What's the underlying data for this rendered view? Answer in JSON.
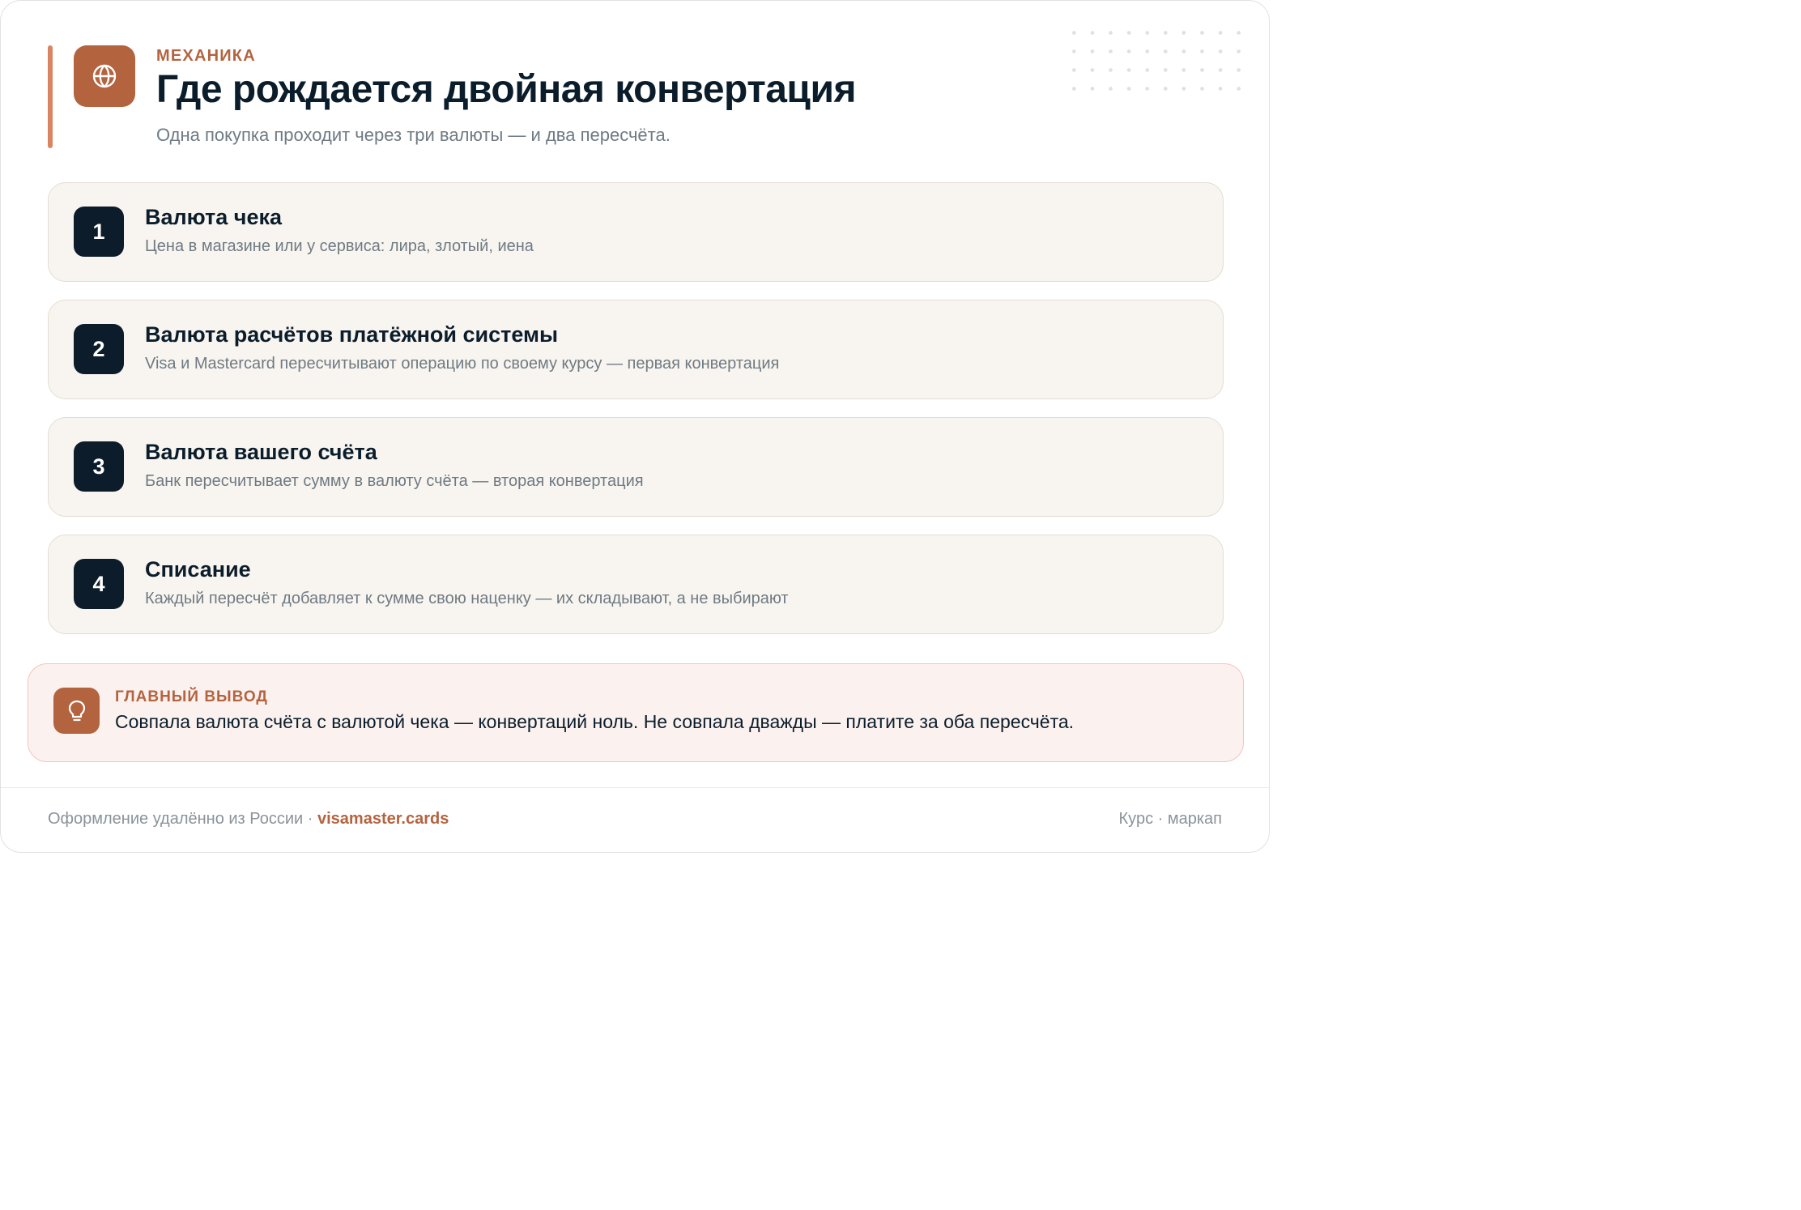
{
  "header": {
    "eyebrow": "МЕХАНИКА",
    "title": "Где рождается двойная конвертация",
    "subtitle": "Одна покупка проходит через три валюты — и два пересчёта.",
    "icon": "globe-icon"
  },
  "steps": [
    {
      "number": "1",
      "title": "Валюта чека",
      "description": "Цена в магазине или у сервиса: лира, злотый, иена"
    },
    {
      "number": "2",
      "title": "Валюта расчётов платёжной системы",
      "description": "Visa и Mastercard пересчитывают операцию по своему курсу — первая конвертация"
    },
    {
      "number": "3",
      "title": "Валюта вашего счёта",
      "description": "Банк пересчитывает сумму в валюту счёта — вторая конвертация"
    },
    {
      "number": "4",
      "title": "Списание",
      "description": "Каждый пересчёт добавляет к сумме свою наценку — их складывают, а не выбирают"
    }
  ],
  "takeaway": {
    "label": "ГЛАВНЫЙ ВЫВОД",
    "text": "Совпала валюта счёта с валютой чека — конвертаций ноль. Не совпала дважды — платите за оба пересчёта.",
    "icon": "lightbulb-icon"
  },
  "footer": {
    "left_text": "Оформление удалённо из России · ",
    "brand": "visamaster.cards",
    "right_text": "Курс · маркап"
  },
  "colors": {
    "accent": "#b4633f",
    "dark": "#0c1c2a",
    "step_bg": "#f8f5f0",
    "takeaway_bg": "#fbf1ef"
  }
}
